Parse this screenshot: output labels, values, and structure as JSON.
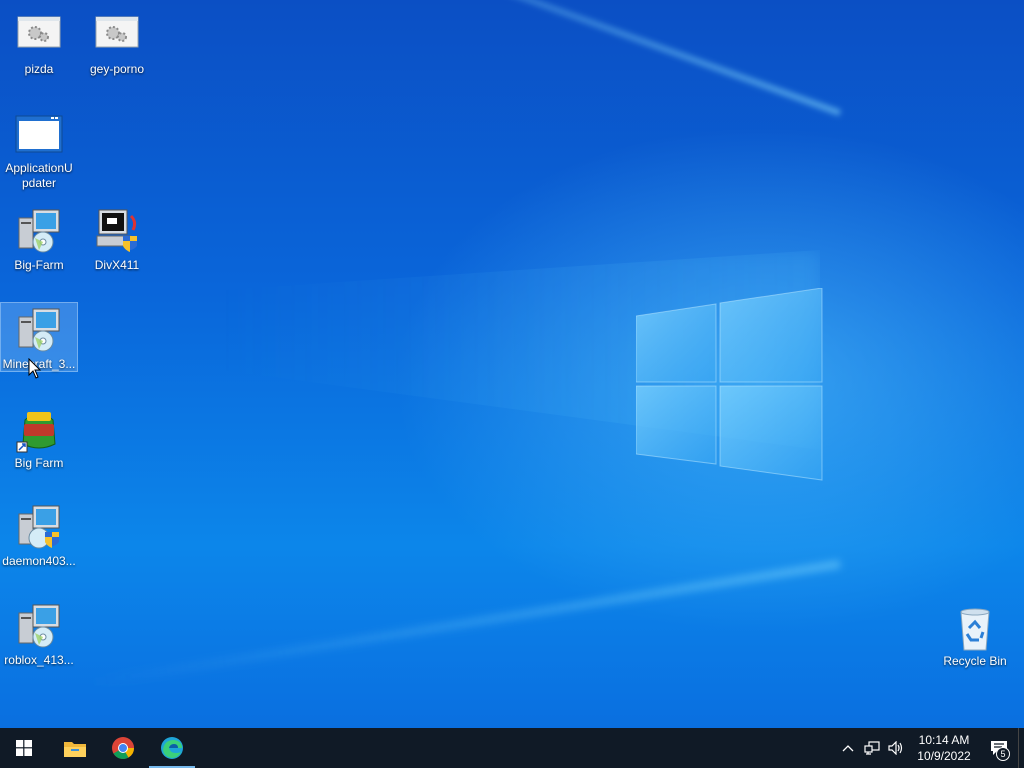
{
  "desktop": {
    "icons": [
      {
        "label": "pizda",
        "type": "gear-window"
      },
      {
        "label": "gey-porno",
        "type": "gear-window"
      },
      {
        "label": "ApplicationUpdater",
        "type": "blank-window"
      },
      {
        "label": "Big-Farm",
        "type": "installer"
      },
      {
        "label": "DivX411",
        "type": "installer-shield"
      },
      {
        "label": "Minecraft_3...",
        "type": "installer",
        "selected": true
      },
      {
        "label": "Big Farm",
        "type": "shortcut-bigfarm"
      },
      {
        "label": "daemon403...",
        "type": "installer-shield"
      },
      {
        "label": "roblox_413...",
        "type": "installer"
      }
    ],
    "recycle_bin": {
      "label": "Recycle Bin"
    }
  },
  "taskbar": {
    "start_icon": "windows-start-icon",
    "pinned": [
      {
        "name": "file-explorer-icon"
      },
      {
        "name": "chrome-icon"
      },
      {
        "name": "edge-icon",
        "active": true
      }
    ],
    "tray": {
      "icons": [
        "chevron-up-icon",
        "network-icon",
        "volume-icon"
      ],
      "time": "10:14 AM",
      "date": "10/9/2022",
      "notification_count": "5"
    }
  },
  "colors": {
    "taskbar": "#101a26",
    "desktop_accent": "#0a66da",
    "active_indicator": "#76b9ed"
  }
}
